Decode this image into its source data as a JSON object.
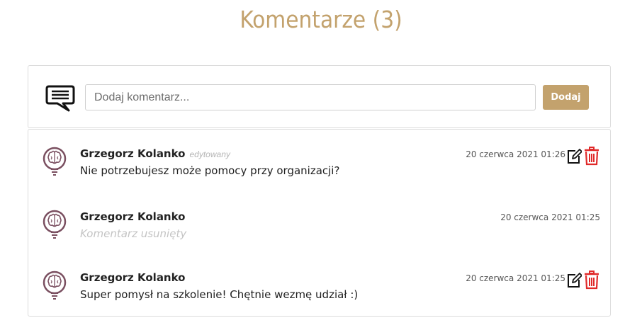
{
  "header": {
    "title": "Komentarze (3)"
  },
  "add_comment": {
    "placeholder": "Dodaj komentarz...",
    "button_label": "Dodaj"
  },
  "comments": [
    {
      "author": "Grzegorz Kolanko",
      "edited_label": "edytowany",
      "date": "20 czerwca 2021 01:26",
      "text": "Nie potrzebujesz może pomocy przy organizacji?",
      "deleted": false,
      "actions": true
    },
    {
      "author": "Grzegorz Kolanko",
      "date": "20 czerwca 2021 01:25",
      "text": "Komentarz usunięty",
      "deleted": true,
      "actions": false
    },
    {
      "author": "Grzegorz Kolanko",
      "date": "20 czerwca 2021 01:25",
      "text": "Super pomysł na szkolenie! Chętnie wezmę udział :)",
      "deleted": false,
      "actions": true
    }
  ],
  "colors": {
    "accent": "#c3a26d",
    "avatar": "#7a4f60",
    "delete": "#e02a2a"
  },
  "icons": {
    "chat": "chat-bubble-icon",
    "avatar": "brain-lightbulb-icon",
    "edit": "edit-icon",
    "delete": "trash-icon"
  }
}
